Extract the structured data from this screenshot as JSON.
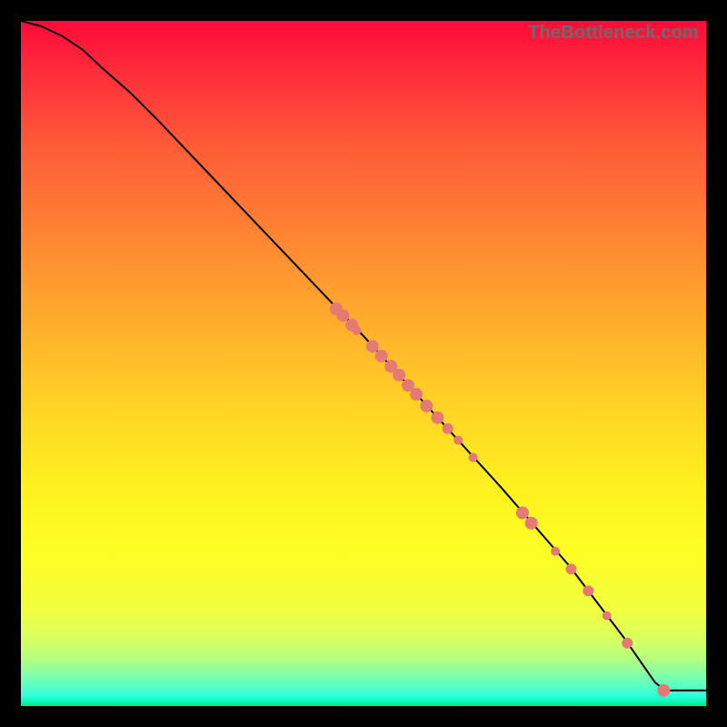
{
  "watermark": "TheBottleneck.com",
  "colors": {
    "frame": "#000000",
    "curve": "#000000",
    "points": "#e47a73"
  },
  "chart_data": {
    "type": "line",
    "title": "",
    "xlabel": "",
    "ylabel": "",
    "xlim": [
      0,
      100
    ],
    "ylim": [
      0,
      100
    ],
    "grid": false,
    "legend": false,
    "series": [
      {
        "name": "bottleneck-curve",
        "x": [
          0,
          3,
          6,
          9,
          12,
          16,
          20,
          30,
          40,
          50,
          60,
          70,
          80,
          88,
          92.5,
          94,
          100
        ],
        "y": [
          100,
          99.2,
          97.8,
          95.8,
          93.0,
          89.5,
          85.5,
          75.0,
          64.5,
          54.0,
          43.0,
          32.0,
          20.5,
          10.0,
          3.5,
          2.3,
          2.3
        ]
      }
    ],
    "points": [
      {
        "x": 46.0,
        "y": 58.0,
        "r": 7
      },
      {
        "x": 47.0,
        "y": 57.0,
        "r": 7
      },
      {
        "x": 48.3,
        "y": 55.6,
        "r": 7
      },
      {
        "x": 49.0,
        "y": 54.8,
        "r": 5
      },
      {
        "x": 51.3,
        "y": 52.5,
        "r": 7
      },
      {
        "x": 52.6,
        "y": 51.1,
        "r": 7
      },
      {
        "x": 54.0,
        "y": 49.6,
        "r": 7
      },
      {
        "x": 55.2,
        "y": 48.3,
        "r": 7
      },
      {
        "x": 56.5,
        "y": 46.8,
        "r": 7
      },
      {
        "x": 57.7,
        "y": 45.5,
        "r": 7
      },
      {
        "x": 59.2,
        "y": 43.8,
        "r": 7
      },
      {
        "x": 60.8,
        "y": 42.1,
        "r": 7
      },
      {
        "x": 62.3,
        "y": 40.5,
        "r": 6
      },
      {
        "x": 63.8,
        "y": 38.8,
        "r": 5
      },
      {
        "x": 66.0,
        "y": 36.3,
        "r": 5
      },
      {
        "x": 73.2,
        "y": 28.2,
        "r": 7
      },
      {
        "x": 74.5,
        "y": 26.7,
        "r": 7
      },
      {
        "x": 78.0,
        "y": 22.6,
        "r": 5
      },
      {
        "x": 80.3,
        "y": 20.0,
        "r": 6
      },
      {
        "x": 82.8,
        "y": 16.8,
        "r": 6
      },
      {
        "x": 85.5,
        "y": 13.2,
        "r": 5
      },
      {
        "x": 88.5,
        "y": 9.2,
        "r": 6
      },
      {
        "x": 93.8,
        "y": 2.3,
        "r": 7
      }
    ]
  }
}
